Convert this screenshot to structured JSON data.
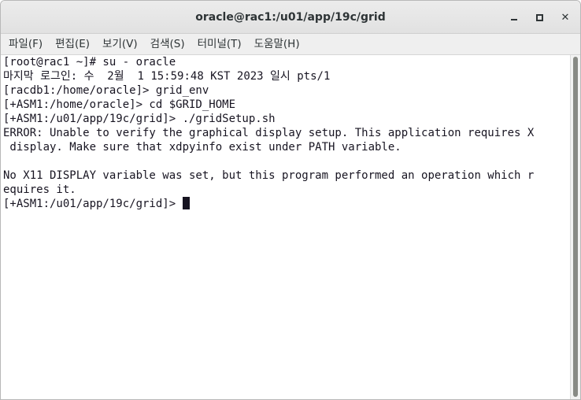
{
  "window": {
    "title": "oracle@rac1:/u01/app/19c/grid"
  },
  "icons": {
    "minimize": "minimize-icon",
    "maximize": "maximize-icon",
    "close": "close-icon"
  },
  "close_glyph": "✕",
  "menubar": {
    "items": [
      {
        "label": "파일(F)"
      },
      {
        "label": "편집(E)"
      },
      {
        "label": "보기(V)"
      },
      {
        "label": "검색(S)"
      },
      {
        "label": "터미널(T)"
      },
      {
        "label": "도움말(H)"
      }
    ]
  },
  "terminal": {
    "lines": [
      "[root@rac1 ~]# su - oracle",
      "마지막 로그인: 수  2월  1 15:59:48 KST 2023 일시 pts/1",
      "[racdb1:/home/oracle]> grid_env",
      "[+ASM1:/home/oracle]> cd $GRID_HOME",
      "[+ASM1:/u01/app/19c/grid]> ./gridSetup.sh",
      "ERROR: Unable to verify the graphical display setup. This application requires X",
      " display. Make sure that xdpyinfo exist under PATH variable.",
      "",
      "No X11 DISPLAY variable was set, but this program performed an operation which r",
      "equires it.",
      "[+ASM1:/u01/app/19c/grid]> "
    ]
  },
  "colors": {
    "terminal_bg": "#ffffff",
    "terminal_fg": "#171421",
    "titlebar_bg": "#e6e6e6"
  }
}
